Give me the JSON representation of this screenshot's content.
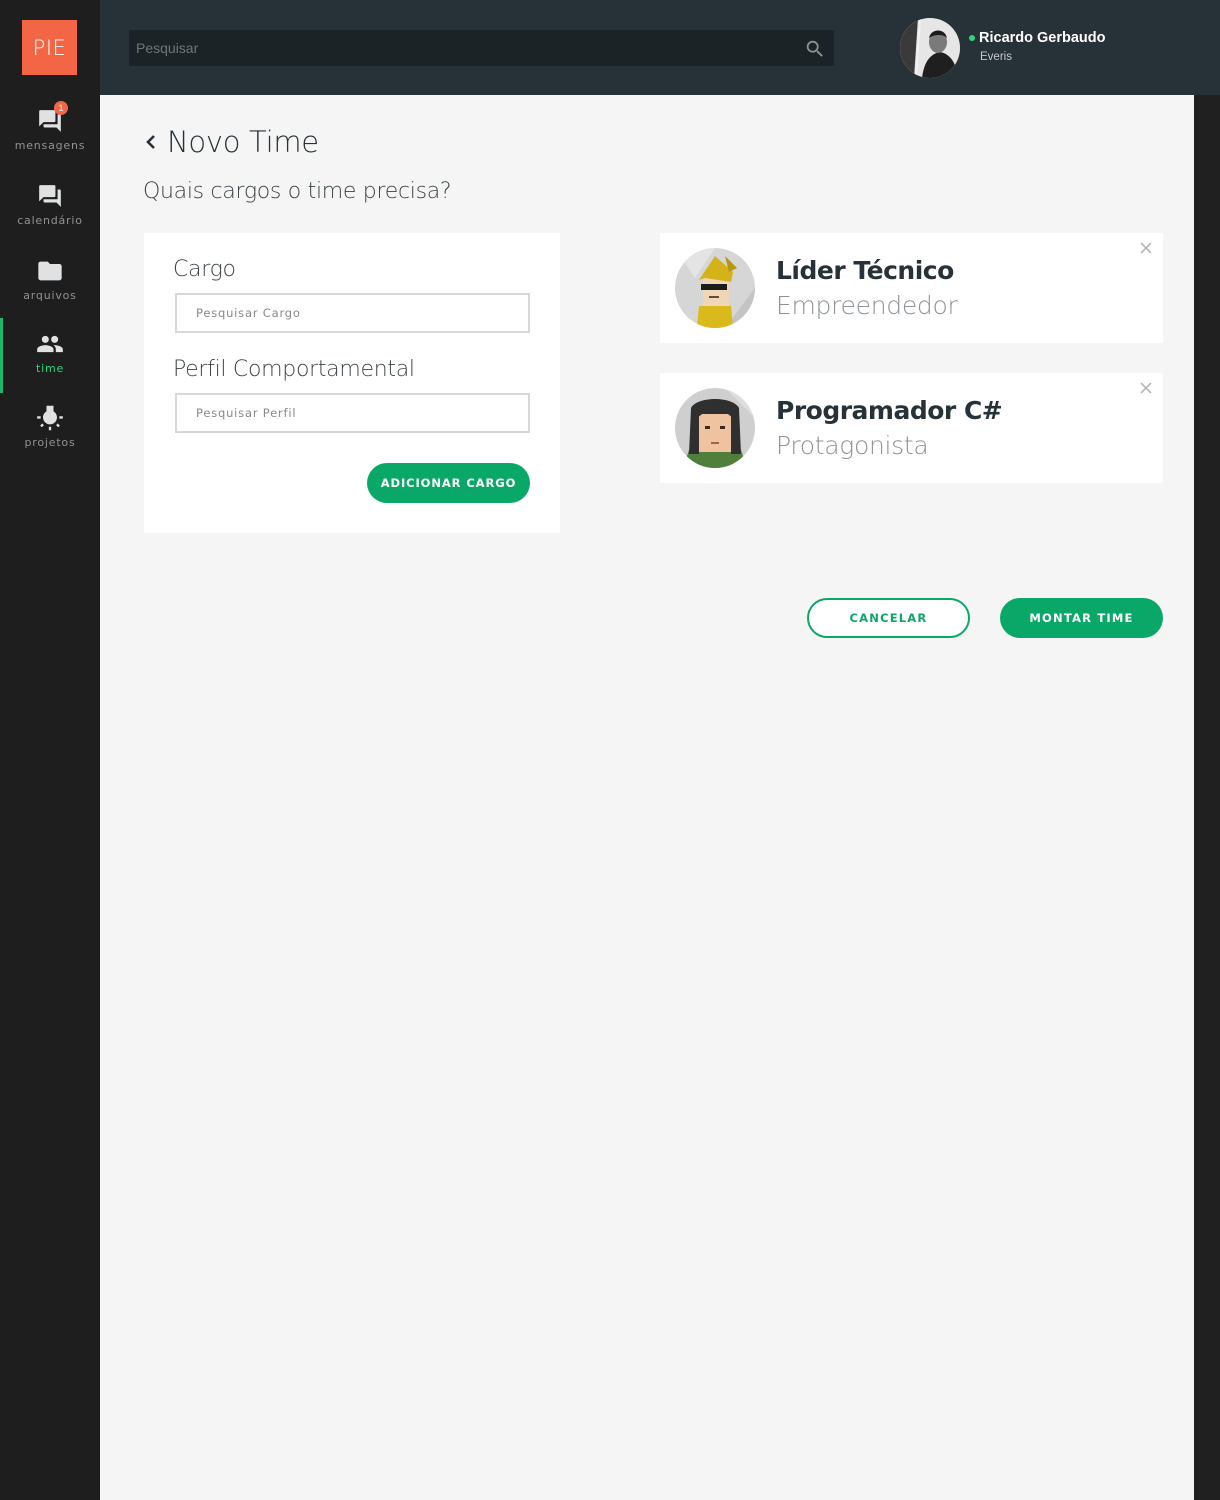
{
  "app": {
    "logo_text": "PIE",
    "accent": "#0aa868",
    "logo_color": "#f26646"
  },
  "sidebar": {
    "items": [
      {
        "label": "mensagens",
        "icon": "chat-icon",
        "badge": "1",
        "active": false
      },
      {
        "label": "calendário",
        "icon": "forum-icon",
        "active": false
      },
      {
        "label": "arquivos",
        "icon": "folder-icon",
        "active": false
      },
      {
        "label": "time",
        "icon": "people-icon",
        "active": true
      },
      {
        "label": "projetos",
        "icon": "lightbulb-icon",
        "active": false
      }
    ]
  },
  "header": {
    "search_placeholder": "Pesquisar",
    "user": {
      "name": "Ricardo Gerbaudo",
      "company": "Everis",
      "status": "online"
    }
  },
  "page": {
    "title": "Novo Time",
    "subtitle": "Quais cargos o time precisa?"
  },
  "form": {
    "cargo_label": "Cargo",
    "cargo_placeholder": "Pesquisar Cargo",
    "perfil_label": "Perfil Comportamental",
    "perfil_placeholder": "Pesquisar Perfil",
    "add_button": "ADICIONAR CARGO"
  },
  "roles": [
    {
      "title": "Líder Técnico",
      "profile": "Empreendedor",
      "avatar": "yellow-character-avatar"
    },
    {
      "title": "Programador C#",
      "profile": "Protagonista",
      "avatar": "dark-hair-character-avatar"
    }
  ],
  "actions": {
    "cancel": "CANCELAR",
    "submit": "MONTAR TIME"
  }
}
